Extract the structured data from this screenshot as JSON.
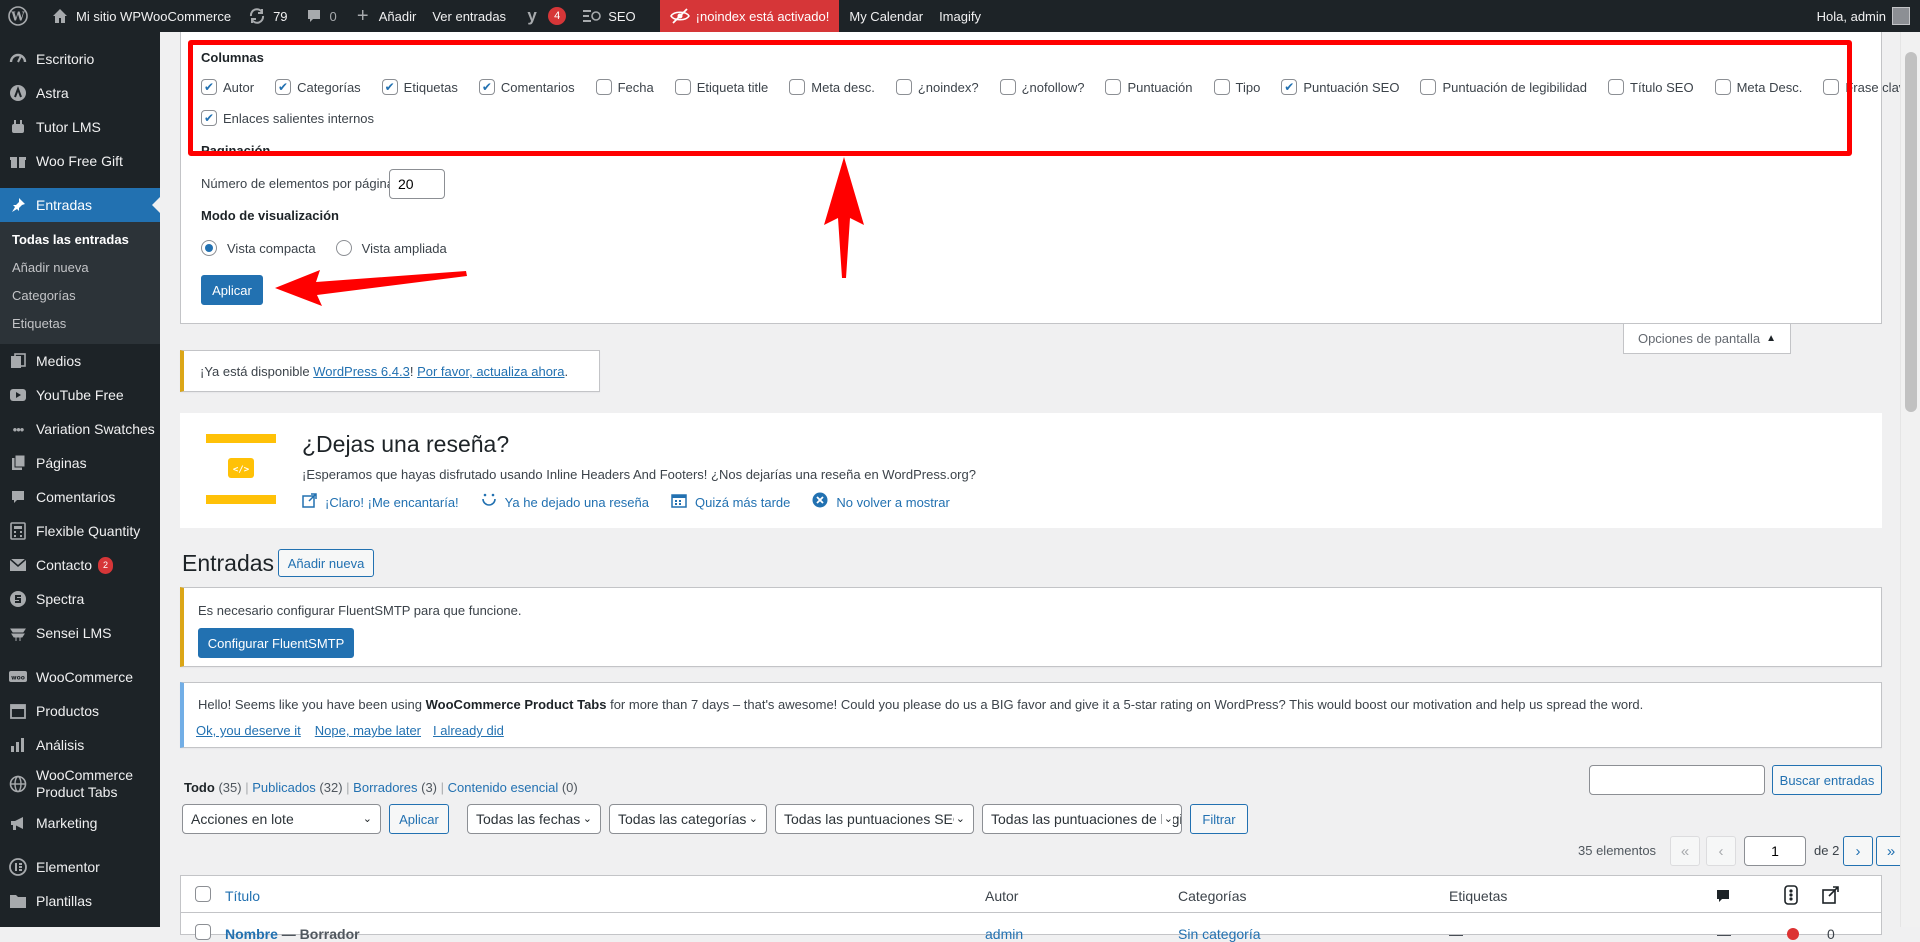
{
  "adminbar": {
    "site_name": "Mi sitio WPWooCommerce",
    "updates_count": "79",
    "comments_count": "0",
    "add_new": "Añadir",
    "view_posts": "Ver entradas",
    "yoast_count": "4",
    "seo": "SEO",
    "noindex": "¡noindex está activado!",
    "calendar": "My Calendar",
    "imagify": "Imagify",
    "greeting": "Hola, admin"
  },
  "sidebar": {
    "items": [
      {
        "label": "Escritorio",
        "icon": "dashboard-icon"
      },
      {
        "label": "Astra",
        "icon": "astra-icon"
      },
      {
        "label": "Tutor LMS",
        "icon": "tutor-icon"
      },
      {
        "label": "Woo Free Gift",
        "icon": "gift-icon"
      },
      {
        "label": "Entradas",
        "icon": "pin-icon"
      },
      {
        "label": "Medios",
        "icon": "media-icon"
      },
      {
        "label": "YouTube Free",
        "icon": "youtube-icon"
      },
      {
        "label": "Variation Swatches",
        "icon": "dots-icon"
      },
      {
        "label": "Páginas",
        "icon": "pages-icon"
      },
      {
        "label": "Comentarios",
        "icon": "comments-icon"
      },
      {
        "label": "Flexible Quantity",
        "icon": "calculator-icon"
      },
      {
        "label": "Contacto",
        "icon": "mail-icon",
        "count": "2"
      },
      {
        "label": "Spectra",
        "icon": "spectra-icon"
      },
      {
        "label": "Sensei LMS",
        "icon": "sensei-icon"
      },
      {
        "label": "WooCommerce",
        "icon": "woo-icon"
      },
      {
        "label": "Productos",
        "icon": "archive-icon"
      },
      {
        "label": "Análisis",
        "icon": "chart-icon"
      },
      {
        "label": "WooCommerce Product Tabs",
        "icon": "globe-icon"
      },
      {
        "label": "Marketing",
        "icon": "megaphone-icon"
      },
      {
        "label": "Elementor",
        "icon": "elementor-icon"
      },
      {
        "label": "Plantillas",
        "icon": "folder-icon"
      }
    ],
    "submenu": [
      "Todas las entradas",
      "Añadir nueva",
      "Categorías",
      "Etiquetas"
    ]
  },
  "screen_options": {
    "columns_legend": "Columnas",
    "columns_row1": [
      {
        "label": "Autor",
        "checked": true
      },
      {
        "label": "Categorías",
        "checked": true
      },
      {
        "label": "Etiquetas",
        "checked": true
      },
      {
        "label": "Comentarios",
        "checked": true
      },
      {
        "label": "Fecha",
        "checked": false
      },
      {
        "label": "Etiqueta title",
        "checked": false
      },
      {
        "label": "Meta desc.",
        "checked": false
      },
      {
        "label": "¿noindex?",
        "checked": false
      },
      {
        "label": "¿nofollow?",
        "checked": false
      },
      {
        "label": "Puntuación",
        "checked": false
      },
      {
        "label": "Tipo",
        "checked": false
      },
      {
        "label": "Puntuación SEO",
        "checked": true
      },
      {
        "label": "Puntuación de legibilidad",
        "checked": false
      },
      {
        "label": "Título SEO",
        "checked": false
      },
      {
        "label": "Meta Desc.",
        "checked": false
      },
      {
        "label": "Frase clave",
        "checked": false
      }
    ],
    "columns_row2": [
      {
        "label": "Enlaces salientes internos",
        "checked": true
      }
    ],
    "pagination_legend": "Paginación",
    "per_page_label": "Número de elementos por página:",
    "per_page_value": "20",
    "view_mode_legend": "Modo de visualización",
    "view_compact": "Vista compacta",
    "view_extended": "Vista ampliada",
    "apply": "Aplicar",
    "toggle": "Opciones de pantalla"
  },
  "update_notice": {
    "prefix": "¡Ya está disponible ",
    "version_link": "WordPress 6.4.3",
    "middle": "! ",
    "update_link": "Por favor, actualiza ahora",
    "suffix": "."
  },
  "review": {
    "title": "¿Dejas una reseña?",
    "text": "¡Esperamos que hayas disfrutado usando Inline Headers And Footers! ¿Nos dejarías una reseña en WordPress.org?",
    "actions": [
      {
        "label": "¡Claro! ¡Me encantaría!",
        "icon": "external-link-icon"
      },
      {
        "label": "Ya he dejado una reseña",
        "icon": "smile-icon"
      },
      {
        "label": "Quizá más tarde",
        "icon": "calendar-icon"
      },
      {
        "label": "No volver a mostrar",
        "icon": "dismiss-icon"
      }
    ]
  },
  "page": {
    "title": "Entradas",
    "add_new": "Añadir nueva"
  },
  "smtp_notice": {
    "text": "Es necesario configurar FluentSMTP para que funcione.",
    "button": "Configurar FluentSMTP"
  },
  "tabs_notice": {
    "text_before": "Hello! Seems like you have been using ",
    "plugin": "WooCommerce Product Tabs",
    "text_after": " for more than 7 days – that's awesome! Could you please do us a BIG favor and give it a 5-star rating on WordPress? This would boost our motivation and help us spread the word.",
    "links": [
      "Ok, you deserve it",
      "Nope, maybe later",
      "I already did"
    ]
  },
  "views": [
    {
      "label": "Todo",
      "count": "(35)"
    },
    {
      "label": "Publicados",
      "count": "(32)"
    },
    {
      "label": "Borradores",
      "count": "(3)"
    },
    {
      "label": "Contenido esencial",
      "count": "(0)"
    }
  ],
  "search": {
    "button": "Buscar entradas",
    "value": ""
  },
  "filters": {
    "bulk": "Acciones en lote",
    "apply": "Aplicar",
    "dates": "Todas las fechas",
    "categories": "Todas las categorías",
    "seo_scores": "Todas las puntuaciones SEO",
    "readability": "Todas las puntuaciones de legibilidad",
    "filter": "Filtrar"
  },
  "pagination": {
    "count": "35 elementos",
    "first": "«",
    "prev": "‹",
    "current": "1",
    "of": "de 2",
    "next": "›",
    "last": "»"
  },
  "table": {
    "headers": {
      "title": "Título",
      "author": "Autor",
      "categories": "Categorías",
      "tags": "Etiquetas"
    },
    "rows": [
      {
        "title": "Nombre",
        "state": " — Borrador",
        "author": "admin",
        "categories": "Sin categoría",
        "tags": "—",
        "comments": "—",
        "links": "0",
        "seo_dot_color": "#dc3232"
      }
    ]
  },
  "colors": {
    "accent": "#2271b1",
    "sidebar": "#1d2327",
    "highlight": "#ff0000",
    "warning": "#dba617"
  }
}
